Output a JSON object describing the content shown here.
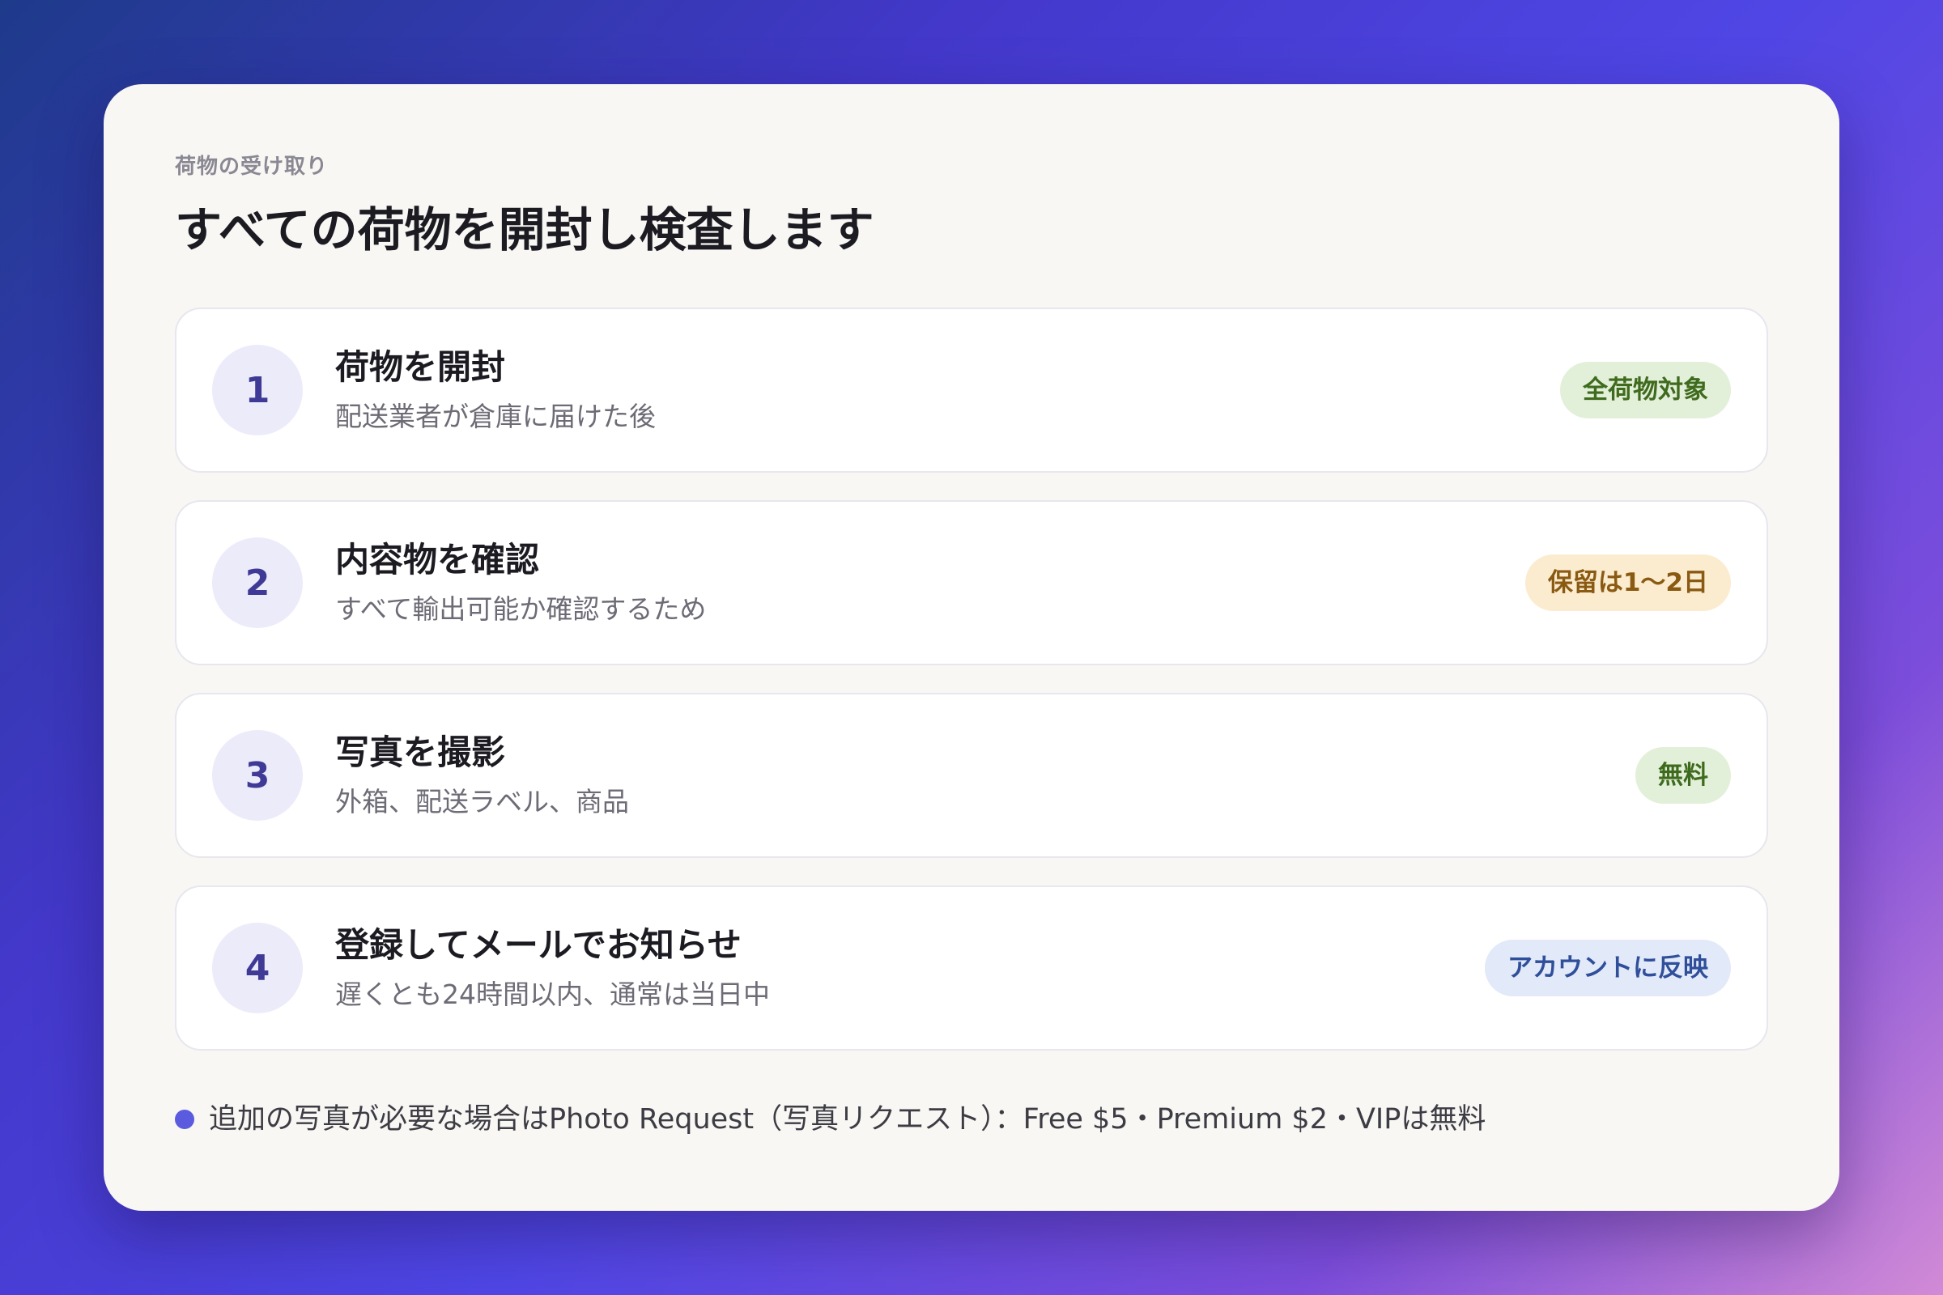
{
  "header": {
    "eyebrow": "荷物の受け取り",
    "title": "すべての荷物を開封し検査します"
  },
  "steps": [
    {
      "number": "1",
      "title": "荷物を開封",
      "description": "配送業者が倉庫に届けた後",
      "badge": "全荷物対象",
      "badge_color": "#e3f0d9"
    },
    {
      "number": "2",
      "title": "内容物を確認",
      "description": "すべて輸出可能か確認するため",
      "badge": "保留は1〜2日",
      "badge_color": "#fbecd0"
    },
    {
      "number": "3",
      "title": "写真を撮影",
      "description": "外箱、配送ラベル、商品",
      "badge": "無料",
      "badge_color": "#e3f0d9"
    },
    {
      "number": "4",
      "title": "登録してメールでお知らせ",
      "description": "遅くとも24時間以内、通常は当日中",
      "badge": "アカウントに反映",
      "badge_color": "#e2e9f8"
    }
  ],
  "footnote": {
    "text": "追加の写真が必要な場合はPhoto Request（写真リクエスト）：Free $5・Premium $2・VIPは無料",
    "dot_color": "#5b5be0"
  }
}
